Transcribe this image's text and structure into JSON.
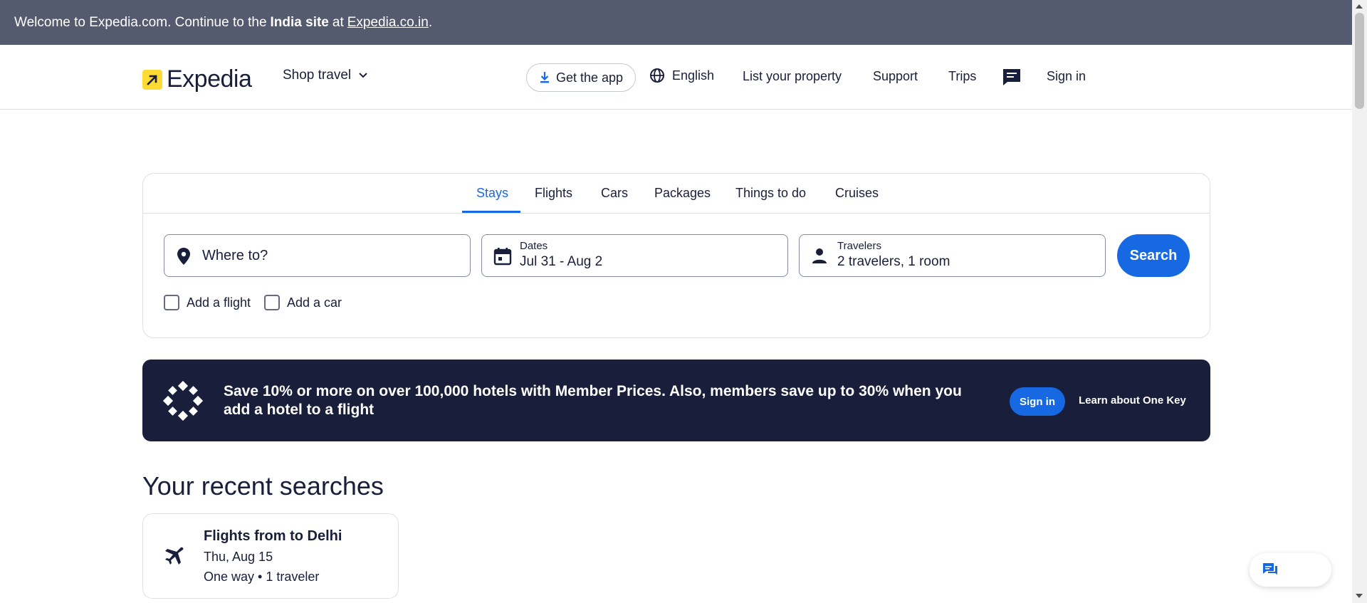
{
  "banner": {
    "prefix": "Welcome to Expedia.com. Continue to the",
    "bold": "India site",
    "mid": "at",
    "link": "Expedia.co.in",
    "suffix": "."
  },
  "header": {
    "brand": "Expedia",
    "shop_travel": "Shop travel",
    "get_app": "Get the app",
    "language": "English",
    "list_property": "List your property",
    "support": "Support",
    "trips": "Trips",
    "sign_in": "Sign in"
  },
  "tabs": [
    {
      "label": "Stays",
      "active": true
    },
    {
      "label": "Flights",
      "active": false
    },
    {
      "label": "Cars",
      "active": false
    },
    {
      "label": "Packages",
      "active": false
    },
    {
      "label": "Things to do",
      "active": false
    },
    {
      "label": "Cruises",
      "active": false
    }
  ],
  "search": {
    "destination_placeholder": "Where to?",
    "dates_label": "Dates",
    "dates_value": "Jul 31 - Aug 2",
    "travelers_label": "Travelers",
    "travelers_value": "2 travelers, 1 room",
    "button": "Search",
    "add_flight": "Add a flight",
    "add_car": "Add a car"
  },
  "promo": {
    "text": "Save 10% or more on over 100,000 hotels with Member Prices. Also, members save up to 30% when you add a hotel to a flight",
    "sign_in": "Sign in",
    "learn": "Learn about One Key"
  },
  "recent": {
    "title": "Your recent searches",
    "items": [
      {
        "title": "Flights from to Delhi",
        "date": "Thu, Aug 15",
        "meta": "One way • 1 traveler"
      }
    ]
  },
  "colors": {
    "banner_bg": "#545b6e",
    "brand_yellow": "#fddb32",
    "accent_blue": "#1668e3",
    "navy": "#191e3b"
  }
}
